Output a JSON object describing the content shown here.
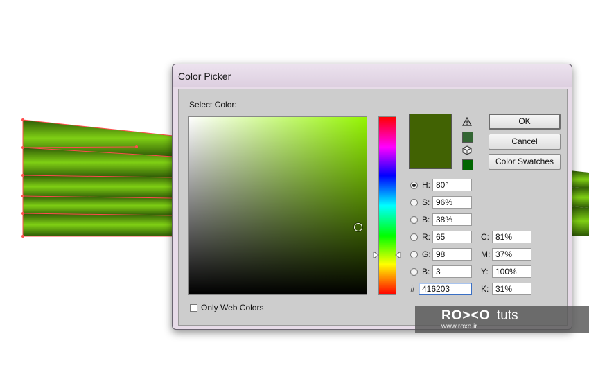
{
  "dialog": {
    "title": "Color Picker",
    "select_color_label": "Select Color:",
    "only_web_colors_label": "Only Web Colors",
    "only_web_colors_checked": false
  },
  "colors": {
    "selected": "#416203",
    "field_hue": "#95f503",
    "web_safe_swatch": "#336633",
    "cmyk_swatch": "#006600"
  },
  "buttons": {
    "ok": "OK",
    "cancel": "Cancel",
    "swatches": "Color Swatches"
  },
  "hsb": {
    "h": {
      "label": "H:",
      "value": "80°",
      "selected": true
    },
    "s": {
      "label": "S:",
      "value": "96%",
      "selected": false
    },
    "b": {
      "label": "B:",
      "value": "38%",
      "selected": false
    }
  },
  "rgb": {
    "r": {
      "label": "R:",
      "value": "65",
      "selected": false
    },
    "g": {
      "label": "G:",
      "value": "98",
      "selected": false
    },
    "b": {
      "label": "B:",
      "value": "3",
      "selected": false
    }
  },
  "cmyk": {
    "c": {
      "label": "C:",
      "value": "81%"
    },
    "m": {
      "label": "M:",
      "value": "37%"
    },
    "y": {
      "label": "Y:",
      "value": "100%"
    },
    "k": {
      "label": "K:",
      "value": "31%"
    }
  },
  "hex": {
    "label": "#",
    "value": "416203"
  },
  "watermark": {
    "logo": "RO><O",
    "tuts": "tuts",
    "url": "www.roxo.ir"
  }
}
